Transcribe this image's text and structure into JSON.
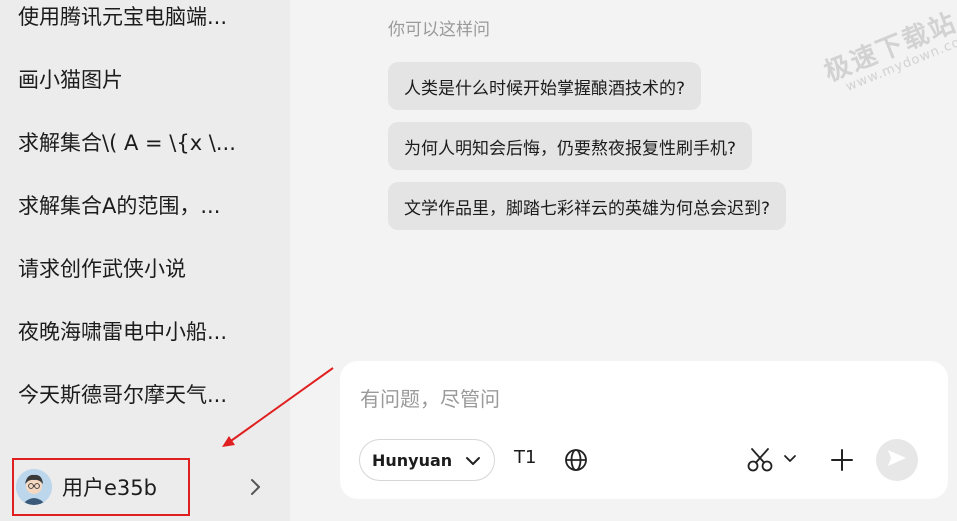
{
  "sidebar": {
    "history": [
      {
        "label": "使用腾讯元宝电脑端..."
      },
      {
        "label": "画小猫图片"
      },
      {
        "label": "求解集合\\( A = \\{x \\..."
      },
      {
        "label": "求解集合A的范围，..."
      },
      {
        "label": "请求创作武侠小说"
      },
      {
        "label": "夜晚海啸雷电中小船..."
      },
      {
        "label": "今天斯德哥尔摩天气..."
      }
    ],
    "user": {
      "name": "用户e35b",
      "avatar_icon": "user-avatar-icon",
      "chevron_icon": "chevron-right-icon"
    }
  },
  "main": {
    "hint_label": "你可以这样问",
    "suggestions": [
      {
        "text": "人类是什么时候开始掌握酿酒技术的?"
      },
      {
        "text": "为何人明知会后悔，仍要熬夜报复性刷手机?"
      },
      {
        "text": "文学作品里，脚踏七彩祥云的英雄为何总会迟到?"
      }
    ]
  },
  "watermark": {
    "line1": "极速下载站",
    "line2": "www.mydown.com"
  },
  "composer": {
    "placeholder": "有问题，尽管问",
    "model": "Hunyuan",
    "t1_label": "T1",
    "icons": [
      "globe-icon",
      "scissors-icon",
      "plus-icon",
      "send-icon"
    ]
  },
  "colors": {
    "annotation_red": "#e02020",
    "sidebar_bg": "#ececec",
    "main_bg": "#f3f3f3"
  }
}
